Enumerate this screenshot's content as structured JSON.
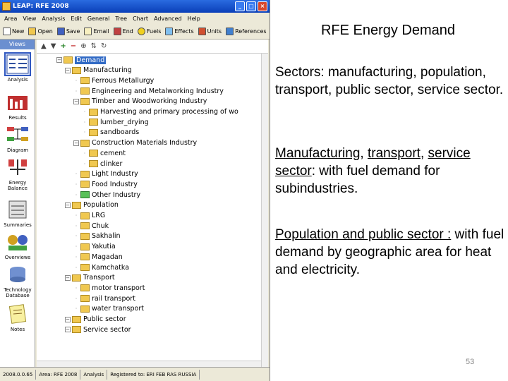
{
  "window": {
    "title": "LEAP: RFE 2008",
    "menu": [
      "Area",
      "View",
      "Analysis",
      "Edit",
      "General",
      "Tree",
      "Chart",
      "Advanced",
      "Help"
    ],
    "toolbar": [
      "New",
      "Open",
      "Save",
      "Email",
      "End",
      "Fuels",
      "Effects",
      "Units",
      "References"
    ]
  },
  "views": {
    "header": "Views",
    "items": [
      "Analysis",
      "Results",
      "Diagram",
      "Energy Balance",
      "Summaries",
      "Overviews",
      "Technology Database",
      "Notes"
    ]
  },
  "tree": {
    "nodes": [
      {
        "label": "Demand",
        "level": 0,
        "type": "exp"
      },
      {
        "label": "Manufacturing",
        "level": 1,
        "type": "exp"
      },
      {
        "label": "Ferrous Metallurgy",
        "level": 2,
        "type": "leaf"
      },
      {
        "label": "Engineering and Metalworking Industry",
        "level": 2,
        "type": "leaf"
      },
      {
        "label": "Timber and Woodworking Industry",
        "level": 2,
        "type": "exp"
      },
      {
        "label": "Harvesting and primary processing of wo",
        "level": 3,
        "type": "leaf"
      },
      {
        "label": "lumber_drying",
        "level": 3,
        "type": "leaf"
      },
      {
        "label": "sandboards",
        "level": 3,
        "type": "leaf"
      },
      {
        "label": "Construction Materials Industry",
        "level": 2,
        "type": "exp"
      },
      {
        "label": "cement",
        "level": 3,
        "type": "leaf"
      },
      {
        "label": "clinker",
        "level": 3,
        "type": "leaf"
      },
      {
        "label": "Light Industry",
        "level": 2,
        "type": "leaf"
      },
      {
        "label": "Food Industry",
        "level": 2,
        "type": "leaf"
      },
      {
        "label": "Other Industry",
        "level": 2,
        "type": "leaf",
        "green": true
      },
      {
        "label": "Population",
        "level": 1,
        "type": "exp"
      },
      {
        "label": "LRG",
        "level": 2,
        "type": "leaf"
      },
      {
        "label": "Chuk",
        "level": 2,
        "type": "leaf"
      },
      {
        "label": "Sakhalin",
        "level": 2,
        "type": "leaf"
      },
      {
        "label": "Yakutia",
        "level": 2,
        "type": "leaf"
      },
      {
        "label": "Magadan",
        "level": 2,
        "type": "leaf"
      },
      {
        "label": "Kamchatka",
        "level": 2,
        "type": "leaf"
      },
      {
        "label": "Transport",
        "level": 1,
        "type": "exp"
      },
      {
        "label": "motor transport",
        "level": 2,
        "type": "leaf"
      },
      {
        "label": "rail transport",
        "level": 2,
        "type": "leaf"
      },
      {
        "label": "water transport",
        "level": 2,
        "type": "leaf"
      },
      {
        "label": "Public sector",
        "level": 1,
        "type": "exp"
      },
      {
        "label": "Service sector",
        "level": 1,
        "type": "exp"
      }
    ]
  },
  "statusbar": [
    "2008.0.0.65",
    "Area: RFE 2008",
    "Analysis",
    "Registered to: ERI FEB RAS RUSSIA"
  ],
  "slide": {
    "title": "RFE Energy Demand",
    "p1": "Sectors: manufacturing, population, transport, public sector, service sector.",
    "p2_u1": "Manufacturing",
    "p2_sep1": ", ",
    "p2_u2": "transport",
    "p2_sep2": ", ",
    "p2_u3": "service sector",
    "p2_rest": ": with fuel demand for subindustries.",
    "p3_u": "Population and public sector :",
    "p3_rest": " with fuel demand by geographic area for heat and electricity.",
    "page": "53"
  },
  "colors": {
    "titlebar": "#0a3fb8",
    "selection": "#316ac5",
    "folder": "#f0c850"
  }
}
